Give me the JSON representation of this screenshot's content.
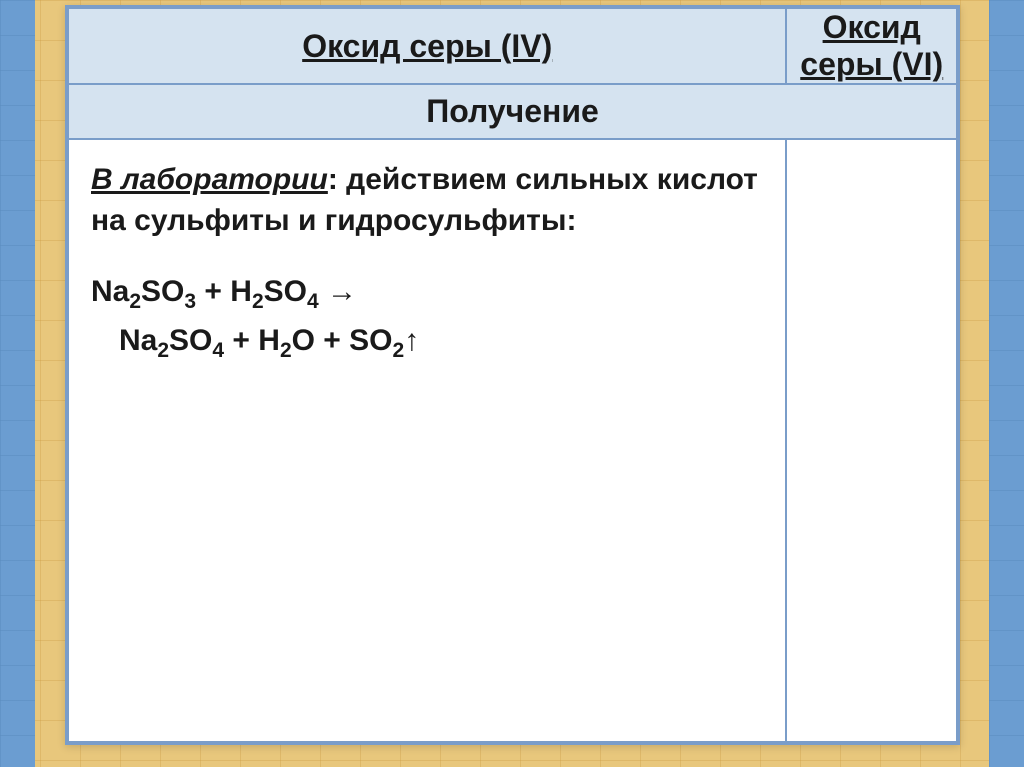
{
  "headers": {
    "col1": "Оксид серы (IV)",
    "col2": "Оксид серы (VI)"
  },
  "section_title": "Получение",
  "content": {
    "lab_word": "В лаборатории",
    "lab_text_rest": ": действием сильных кислот на сульфиты и гидросульфиты:",
    "formula1_parts": {
      "p1": "Na",
      "s1": "2",
      "p2": "SO",
      "s2": "3",
      "p3": " + H",
      "s3": "2",
      "p4": "SO",
      "s4": "4",
      "p5": " →"
    },
    "formula2_parts": {
      "p1": "Na",
      "s1": "2",
      "p2": "SO",
      "s2": "4",
      "p3": " + H",
      "s3": "2",
      "p4": "O + SO",
      "s4": "2",
      "p5": "↑"
    }
  }
}
